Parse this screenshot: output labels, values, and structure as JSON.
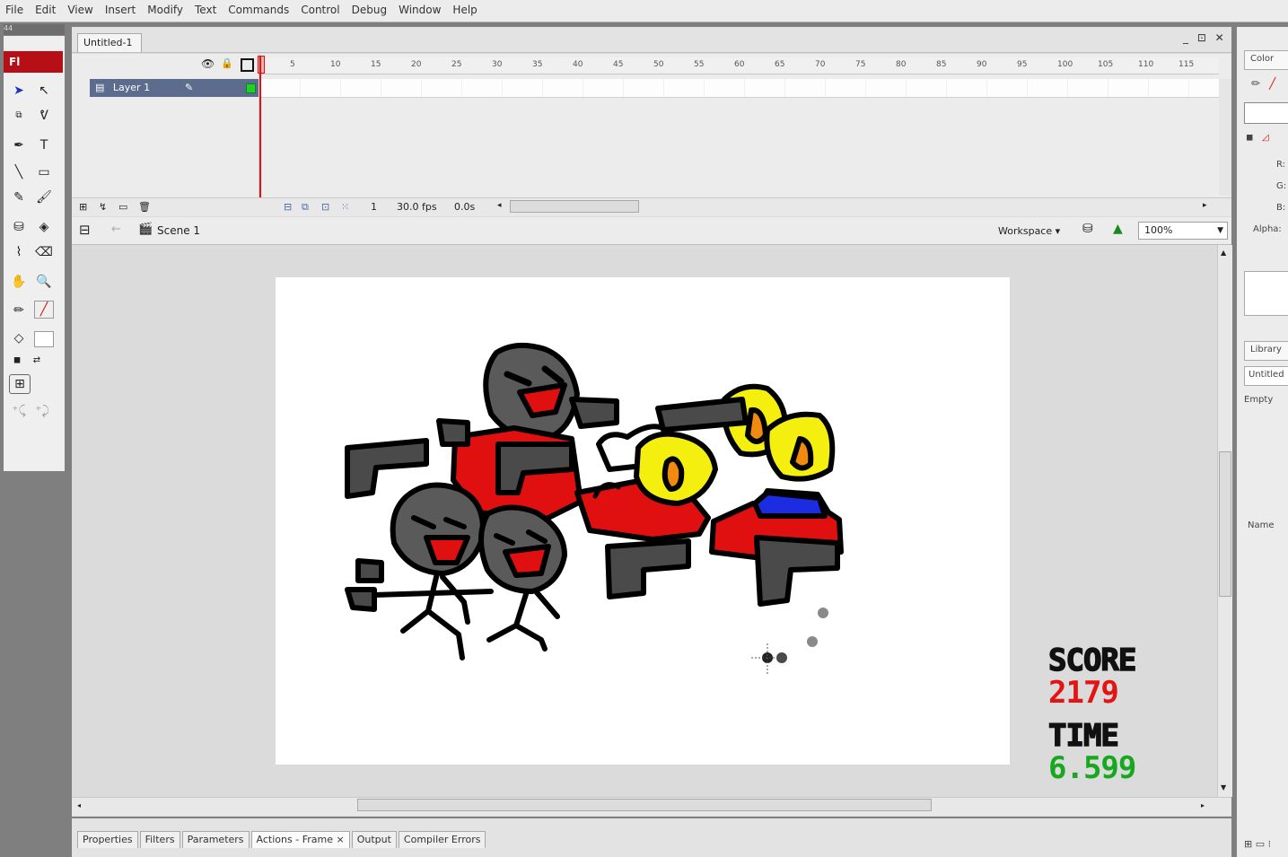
{
  "menu": [
    "File",
    "Edit",
    "View",
    "Insert",
    "Modify",
    "Text",
    "Commands",
    "Control",
    "Debug",
    "Window",
    "Help"
  ],
  "tools_header": "44",
  "logo": "Fl",
  "document": {
    "tab": "Untitled-1",
    "window_buttons": "_ ⊡ ✕"
  },
  "timeline": {
    "layer_name": "Layer 1",
    "ruler_ticks": [
      "5",
      "10",
      "15",
      "20",
      "25",
      "30",
      "35",
      "40",
      "45",
      "50",
      "55",
      "60",
      "65",
      "70",
      "75",
      "80",
      "85",
      "90",
      "95",
      "100",
      "105",
      "110",
      "115"
    ],
    "current_frame": "1",
    "frame_rate": "30.0 fps",
    "elapsed": "0.0s"
  },
  "edit_bar": {
    "scene": "Scene 1",
    "workspace": "Workspace ▾",
    "zoom": "100%"
  },
  "game_hud": {
    "score_label": "SCORE",
    "score_value": "2179",
    "time_label": "TIME",
    "time_value": "6.599"
  },
  "bottom_tabs": [
    "Properties",
    "Filters",
    "Parameters",
    "Actions - Frame ×",
    "Output",
    "Compiler Errors"
  ],
  "right_panel": {
    "color": "Color",
    "library": "Library",
    "untitled": "Untitled",
    "empty": "Empty",
    "name": "Name",
    "alpha": "Alpha:",
    "r": "R:",
    "g": "G:",
    "b": "B:"
  },
  "colors": {
    "character_red": "#e01010",
    "character_gray": "#5a5a5a",
    "lamp_yellow": "#f5ef10",
    "lamp_orange": "#f08a10",
    "car_blue": "#1c2ce0",
    "score_red": "#e31414",
    "time_green": "#18a820"
  }
}
